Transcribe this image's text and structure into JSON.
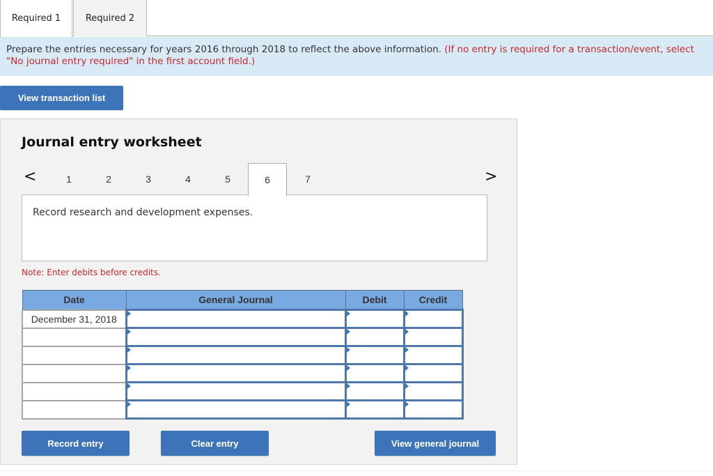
{
  "tabs": [
    {
      "label": "Required 1",
      "active": true
    },
    {
      "label": "Required 2",
      "active": false
    }
  ],
  "instructions": {
    "main": "Prepare the entries necessary for years 2016 through 2018 to reflect the above information.",
    "note": "(If no entry is required for a transaction/event, select \"No journal entry required\" in the first account field.)"
  },
  "view_transaction_list_label": "View transaction list",
  "worksheet": {
    "title": "Journal entry worksheet",
    "prev_icon": "chevron-left-icon",
    "next_icon": "chevron-right-icon",
    "prev_glyph": "<",
    "next_glyph": ">",
    "pages": [
      "1",
      "2",
      "3",
      "4",
      "5",
      "6",
      "7"
    ],
    "current_page": "6",
    "description": "Record research and development expenses.",
    "note": "Note: Enter debits before credits.",
    "table": {
      "headers": [
        "Date",
        "General Journal",
        "Debit",
        "Credit"
      ],
      "rows": [
        {
          "date": "December 31, 2018",
          "account": "",
          "debit": "",
          "credit": ""
        },
        {
          "date": "",
          "account": "",
          "debit": "",
          "credit": ""
        },
        {
          "date": "",
          "account": "",
          "debit": "",
          "credit": ""
        },
        {
          "date": "",
          "account": "",
          "debit": "",
          "credit": ""
        },
        {
          "date": "",
          "account": "",
          "debit": "",
          "credit": ""
        },
        {
          "date": "",
          "account": "",
          "debit": "",
          "credit": ""
        }
      ]
    },
    "buttons": {
      "record": "Record entry",
      "clear": "Clear entry",
      "view_general_journal": "View general journal"
    }
  },
  "colors": {
    "button_blue": "#3d74b9",
    "header_blue": "#78a9e0",
    "instruction_bg": "#d9eaf7",
    "note_red": "#c0282d"
  }
}
